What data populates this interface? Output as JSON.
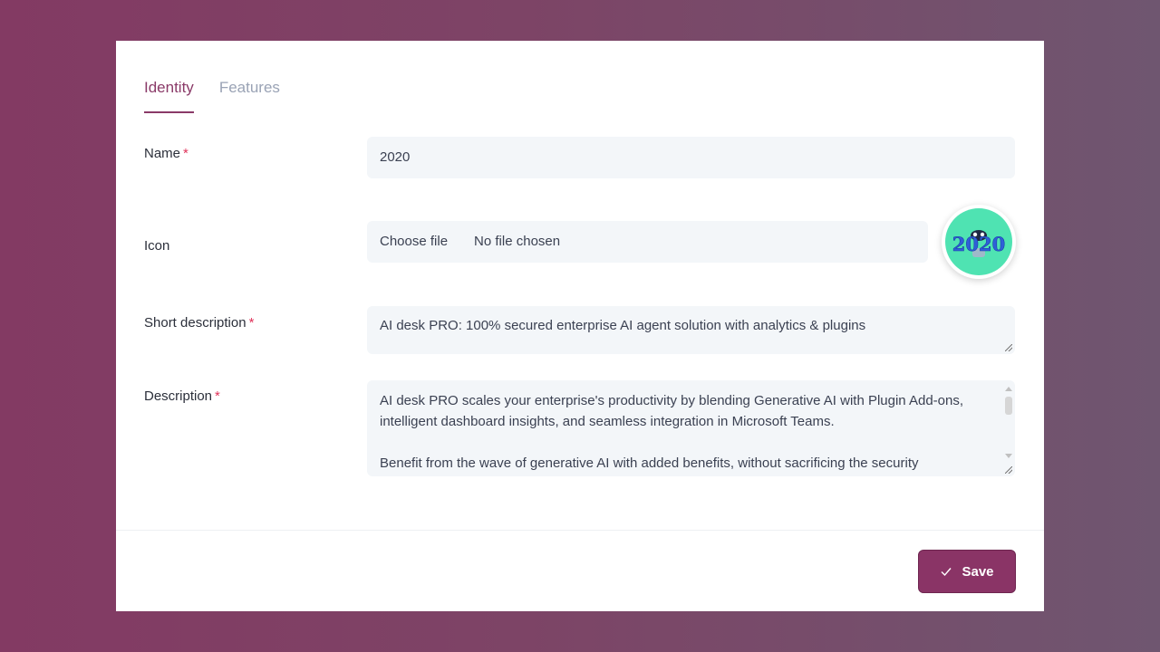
{
  "tabs": [
    {
      "label": "Identity",
      "active": true
    },
    {
      "label": "Features",
      "active": false
    }
  ],
  "form": {
    "name": {
      "label": "Name",
      "required_mark": "*",
      "value": "2020"
    },
    "icon": {
      "label": "Icon",
      "choose_file": "Choose file",
      "status": "No file chosen",
      "preview_text": "2020"
    },
    "short_description": {
      "label": "Short description",
      "required_mark": "*",
      "value": "AI desk PRO: 100% secured enterprise AI agent solution with analytics & plugins"
    },
    "description": {
      "label": "Description",
      "required_mark": "*",
      "paragraph1": "AI desk PRO scales your enterprise's productivity by blending Generative AI with Plugin Add-ons, intelligent dashboard insights, and seamless integration in Microsoft Teams.",
      "paragraph2": "Benefit from the wave of generative AI with added benefits, without sacrificing the security"
    }
  },
  "actions": {
    "save_label": "Save"
  },
  "colors": {
    "accent": "#8a3a68",
    "required": "#e0335a",
    "field_bg": "#f3f6f9",
    "icon_bg": "#4fe3b2"
  }
}
